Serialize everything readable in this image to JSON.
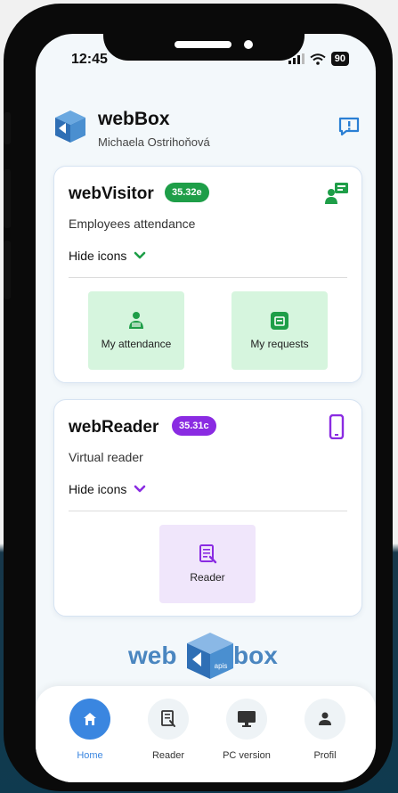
{
  "status": {
    "time": "12:45",
    "battery": "90"
  },
  "header": {
    "title": "webBox",
    "user": "Michaela Ostrihoňová"
  },
  "visitor": {
    "title": "webVisitor",
    "version": "35.32e",
    "subtitle": "Employees attendance",
    "toggle_label": "Hide icons",
    "tiles": [
      {
        "label": "My attendance"
      },
      {
        "label": "My requests"
      }
    ],
    "accent": "#1e9e48",
    "tile_bg": "#d6f5de"
  },
  "reader": {
    "title": "webReader",
    "version": "35.31c",
    "subtitle": "Virtual reader",
    "toggle_label": "Hide icons",
    "tiles": [
      {
        "label": "Reader"
      }
    ],
    "accent": "#8a2be2",
    "tile_bg": "#f0e6fb"
  },
  "footer_logo": {
    "left": "web",
    "mid": "apis",
    "right": "box"
  },
  "tabbar": {
    "items": [
      {
        "label": "Home",
        "icon": "home-icon",
        "active": true
      },
      {
        "label": "Reader",
        "icon": "reader-icon",
        "active": false
      },
      {
        "label": "PC version",
        "icon": "monitor-icon",
        "active": false
      },
      {
        "label": "Profil",
        "icon": "person-icon",
        "active": false
      }
    ]
  }
}
